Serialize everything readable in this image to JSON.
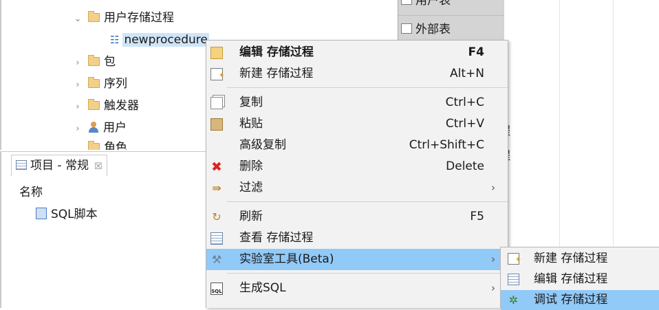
{
  "tree": {
    "items": [
      {
        "label": "用户存储过程",
        "expanded": true
      },
      {
        "label": "newprocedure",
        "selected": true
      },
      {
        "label": "包"
      },
      {
        "label": "序列"
      },
      {
        "label": "触发器"
      },
      {
        "label": "用户"
      },
      {
        "label": "角色"
      }
    ]
  },
  "project_panel": {
    "tab_label": "项目 - 常规",
    "column_header": "名称",
    "items": [
      {
        "label": "SQL脚本"
      }
    ]
  },
  "right_panel": {
    "rows": [
      "用户表",
      "外部表"
    ],
    "cut_texts": [
      "程",
      "程"
    ]
  },
  "context_menu": {
    "items": [
      {
        "icon": "edit-icon",
        "label": "编辑 存储过程",
        "shortcut": "F4",
        "bold": true
      },
      {
        "icon": "new-icon",
        "label": "新建 存储过程",
        "shortcut": "Alt+N"
      },
      {
        "icon": "copy-icon",
        "label": "复制",
        "shortcut": "Ctrl+C"
      },
      {
        "icon": "paste-icon",
        "label": "粘贴",
        "shortcut": "Ctrl+V"
      },
      {
        "icon": "",
        "label": "高级复制",
        "shortcut": "Ctrl+Shift+C"
      },
      {
        "icon": "delete-icon",
        "label": "删除",
        "shortcut": "Delete"
      },
      {
        "icon": "filter-icon",
        "label": "过滤",
        "submenu": true
      },
      {
        "icon": "refresh-icon",
        "label": "刷新",
        "shortcut": "F5"
      },
      {
        "icon": "view-icon",
        "label": "查看 存储过程"
      },
      {
        "icon": "tools-icon",
        "label": "实验室工具(Beta)",
        "submenu": true,
        "highlighted": true
      },
      {
        "icon": "sql-icon",
        "label": "生成SQL",
        "submenu": true
      }
    ]
  },
  "sub_menu": {
    "items": [
      {
        "icon": "new-icon",
        "label": "新建 存储过程"
      },
      {
        "icon": "edit-doc-icon",
        "label": "编辑 存储过程"
      },
      {
        "icon": "debug-icon",
        "label": "调试 存储过程",
        "highlighted": true
      }
    ]
  },
  "colors": {
    "highlight": "#91c9f7",
    "menu_bg": "#f2f2f2",
    "selection": "#cfe4f7"
  }
}
